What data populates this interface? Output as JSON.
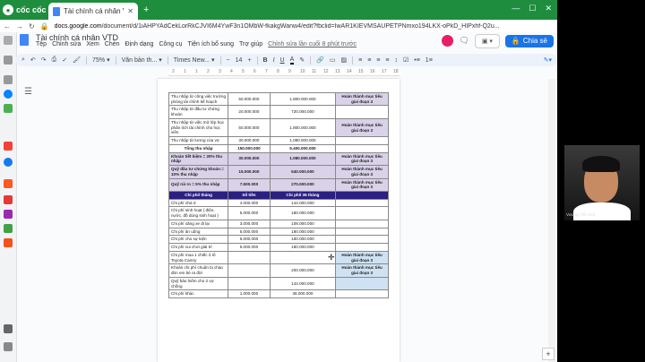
{
  "browser": {
    "brand": "cốc cốc",
    "tab_title": "Tài chính cá nhân VTD - Go...",
    "url_host": "docs.google.com",
    "url_path": "/document/d/1iAHPYAdCekLorRkCJVI6M4YwF3n1OMbW-fkakgWanw4/edit?fbclid=IwAR1KIEVMSAUPETPNmxo194LKX-oPkD_HIPxhf-Q2u..."
  },
  "docs": {
    "title": "Tài chính cá nhân VTD",
    "menu": [
      "Tệp",
      "Chỉnh sửa",
      "Xem",
      "Chèn",
      "Định dạng",
      "Công cụ",
      "Tiện ích bổ sung",
      "Trợ giúp"
    ],
    "last_edit": "Chỉnh sửa lần cuối 8 phút trước",
    "share_label": "Chia sẻ"
  },
  "toolbar": {
    "zoom": "75%",
    "style": "Văn bản th...",
    "font": "Times New...",
    "size": "14",
    "bold": "B",
    "italic": "I",
    "underline": "U",
    "color": "A"
  },
  "ruler": [
    "2",
    "1",
    "1",
    "2",
    "3",
    "4",
    "5",
    "6",
    "7",
    "8",
    "9",
    "10",
    "11",
    "12",
    "13",
    "14",
    "15",
    "16",
    "17",
    "18"
  ],
  "table": {
    "upper_rows": [
      {
        "label": "Thu nhập từ công việc trường phòng tài chính kế hoạch",
        "monthly": "50.000.000",
        "total": "1.800.000.000",
        "status": "Hoàn thành mục tiêu giai đoạn 3",
        "status_color": "purple"
      },
      {
        "label": "Thu nhập từ đầu tư chứng khoán",
        "monthly": "20.000.000",
        "total": "720.000.000",
        "status": "",
        "status_color": ""
      },
      {
        "label": "Thu nhập từ việc mở lớp học phân tích tài chính cho học viên",
        "monthly": "50.000.000",
        "total": "1.800.000.000",
        "status": "Hoàn thành mục tiêu giai đoạn 3",
        "status_color": "purple"
      },
      {
        "label": "Thu nhập từ lương của vợ",
        "monthly": "30.000.000",
        "total": "1.080.000.000",
        "status": "",
        "status_color": ""
      }
    ],
    "total_income": {
      "label": "Tổng thu nhập",
      "monthly": "150.000.000",
      "total": "5.400.000.000"
    },
    "funds": [
      {
        "label": "Khoản tiết kiệm = 20% thu nhập",
        "monthly": "30.000.000",
        "total": "1.080.000.000",
        "status": "Hoàn thành mục tiêu giai đoạn 3"
      },
      {
        "label": "Quỹ đầu tư chứng khoán = 10% thu nhập",
        "monthly": "15.000.000",
        "total": "540.000.000",
        "status": "Hoàn thành mục tiêu giai đoạn 3"
      },
      {
        "label": "Quỹ rủi ro = 5% thu nhập",
        "monthly": "7.500.000",
        "total": "270.000.000",
        "status": "Hoàn thành mục tiêu giai đoạn 3"
      }
    ],
    "header": [
      "Chi phí/ tháng",
      "Số tiền",
      "Chi phí/ 36 tháng",
      ""
    ],
    "expenses": [
      {
        "label": "Chi phí nhà ở",
        "monthly": "4.000.000",
        "total": "144.000.000",
        "status": "",
        "status_color": ""
      },
      {
        "label": "Chi phí sinh hoạt ( điện, nước, đồ dùng sinh hoạt )",
        "monthly": "5.000.000",
        "total": "180.000.000",
        "status": "",
        "status_color": ""
      },
      {
        "label": "Chi phí xăng xe đi lại",
        "monthly": "3.000.000",
        "total": "108.000.000",
        "status": "",
        "status_color": ""
      },
      {
        "label": "Chi phí ăn uống",
        "monthly": "5.000.000",
        "total": "180.000.000",
        "status": "",
        "status_color": ""
      },
      {
        "label": "Chi phí cho sự kiện",
        "monthly": "5.000.000",
        "total": "180.000.000",
        "status": "",
        "status_color": ""
      },
      {
        "label": "Chi phí vui chơi giải trí",
        "monthly": "5.000.000",
        "total": "180.000.000",
        "status": "",
        "status_color": ""
      },
      {
        "label": "Chi phí mua 1 chiếc ô tô Toyota Camry",
        "monthly": "",
        "total": "",
        "status": "Hoàn thành mục tiêu giai đoạn 3",
        "status_color": "blue"
      },
      {
        "label": "Khoản chi phí chuẩn bị chào đón em bé ra đời",
        "monthly": "",
        "total": "200.000.000",
        "status": "Hoàn thành mục tiêu giai đoạn 3",
        "status_color": "blue"
      },
      {
        "label": "Quỹ bảo hiểm cho 2 vợ chồng",
        "monthly": "",
        "total": "144.000.000",
        "status": "",
        "status_color": "blue"
      },
      {
        "label": "Chi phí khác",
        "monthly": "1.000.000",
        "total": "36.000.000",
        "status": "",
        "status_color": ""
      }
    ]
  },
  "webcam": {
    "name": "Vương Tiến Đạt"
  }
}
